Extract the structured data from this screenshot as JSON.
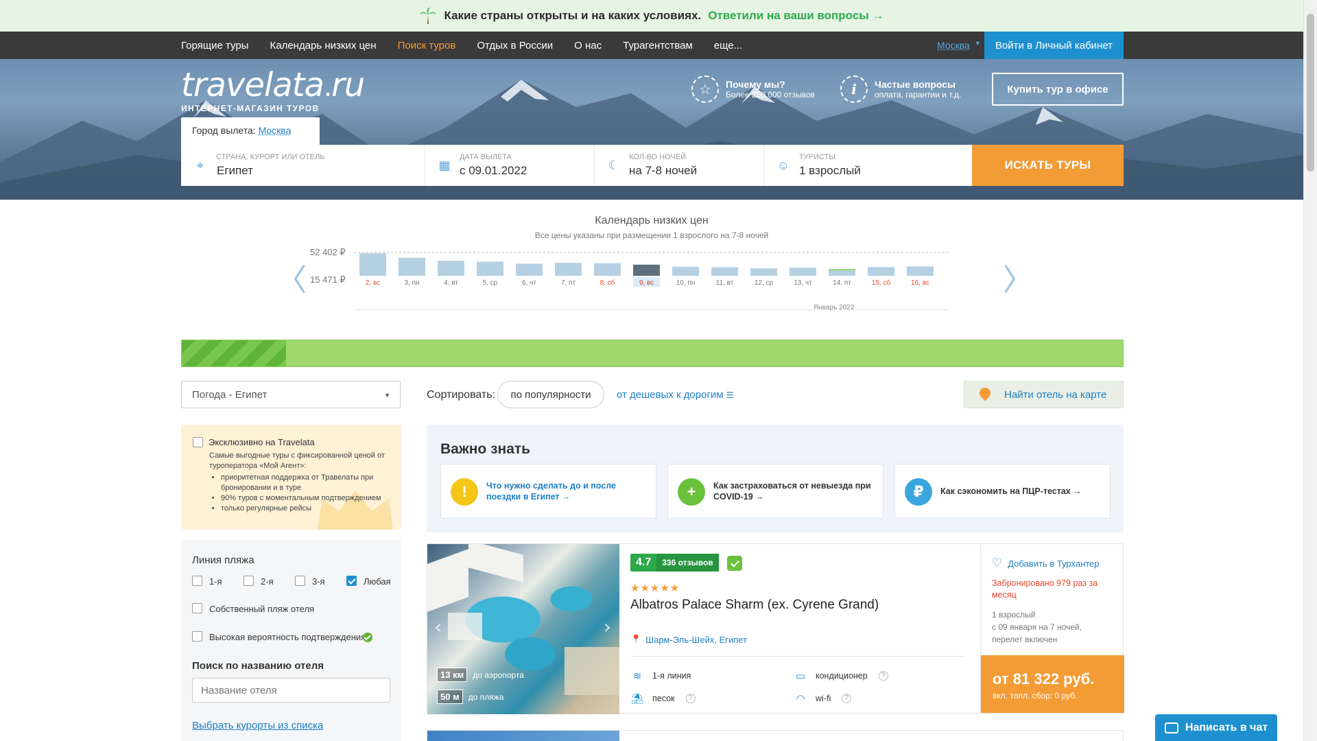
{
  "banner": {
    "question": "Какие страны открыты и на каких условиях.",
    "link": "Ответили на ваши вопросы"
  },
  "nav": {
    "items": [
      "Горящие туры",
      "Календарь низких цен",
      "Поиск туров",
      "Отдых в России",
      "О нас",
      "Турагентствам",
      "еще..."
    ],
    "active_index": 2,
    "city": "Москва",
    "login": "Войти в Личный кабинет"
  },
  "header": {
    "logo": "travelata.ru",
    "logo_main": "travelata",
    "logo_suffix": "ru",
    "tagline": "ИНТЕРНЕТ-МАГАЗИН ТУРОВ",
    "why_title": "Почему мы?",
    "why_sub": "Более 250 000 отзывов",
    "faq_title": "Частые вопросы",
    "faq_sub": "оплата, гарантии и т.д.",
    "office_button": "Купить тур в офисе"
  },
  "search": {
    "departure_label": "Город вылета:",
    "departure_city": "Москва",
    "destination_label": "СТРАНА, КУРОРТ ИЛИ ОТЕЛЬ",
    "destination_value": "Египет",
    "date_label": "ДАТА ВЫЛЕТА",
    "date_value": "с 09.01.2022",
    "nights_label": "КОЛ-ВО НОЧЕЙ",
    "nights_value": "на 7-8 ночей",
    "tourists_label": "ТУРИСТЫ",
    "tourists_value": "1 взрослый",
    "button": "ИСКАТЬ ТУРЫ"
  },
  "calendar": {
    "title": "Календарь низких цен",
    "subtitle": "Все цены указаны при размещении 1 взрослого на 7-8 ночей",
    "max_label": "52 402 ₽",
    "min_label": "15 471 ₽",
    "month": "Январь 2022"
  },
  "chart_data": {
    "type": "bar",
    "categories": [
      "2, вс",
      "3, пн",
      "4, вт",
      "5, ср",
      "6, чт",
      "7, пт",
      "8, сб",
      "9, вс",
      "10, пн",
      "11, вт",
      "12, ср",
      "13, чт",
      "14, пт",
      "15, сб",
      "16, вс"
    ],
    "values": [
      52402,
      41800,
      35000,
      32700,
      28000,
      30100,
      29300,
      25800,
      21000,
      19600,
      17200,
      18900,
      15471,
      20100,
      21700
    ],
    "weekend": [
      true,
      false,
      false,
      false,
      false,
      false,
      true,
      true,
      false,
      false,
      false,
      false,
      false,
      true,
      true
    ],
    "selected_index": 7,
    "min_index": 12,
    "ylim": [
      0,
      52402
    ],
    "colors": {
      "bar": "#b6d0e3",
      "selected": "#5f6f7c",
      "min": "#8fd46a",
      "weekend_label": "#e8472d"
    }
  },
  "progress": {
    "fraction": 0.111
  },
  "sort": {
    "weather": "Погода - Египет",
    "label": "Сортировать:",
    "popular": "по популярности",
    "cheap": "от дешевых к дорогим",
    "map": "Найти отель на карте"
  },
  "exclusive": {
    "title": "Эксклюзивно на Travelata",
    "desc": "Самые выгодные туры с фиксированной ценой от туроператора «Мой Агент»:",
    "points": [
      "приоритетная поддержка от Травелаты при бронировании и в туре",
      "90% туров с моментальным подтверждением",
      "только регулярные рейсы"
    ]
  },
  "filters": {
    "beach_title": "Линия пляжа",
    "beach_options": [
      "1-я",
      "2-я",
      "3-я",
      "Любая"
    ],
    "beach_checked": "Любая",
    "own_beach": "Собственный пляж отеля",
    "high_confirm": "Высокая вероятность подтверждения",
    "name_title": "Поиск по названию отеля",
    "name_placeholder": "Название отеля",
    "resorts_link": "Выбрать курорты из списка"
  },
  "important": {
    "title": "Важно знать",
    "cards": [
      {
        "icon": "!",
        "color": "#f5c518",
        "text": "Что нужно сделать до и после поездки в Египет →",
        "link": true
      },
      {
        "icon": "+",
        "color": "#6bc03c",
        "text": "Как застраховаться от невыезда при COVID-19 →",
        "link": false
      },
      {
        "icon": "₽",
        "color": "#3aa6dd",
        "text": "Как сэкономить на ПЦР-тестах →",
        "link": false
      }
    ]
  },
  "hotel": {
    "rating": "4.7",
    "reviews": "336 отзывов",
    "stars": "★★★★★",
    "name": "Albatros Palace Sharm (ex. Cyrene Grand)",
    "location": "Шарм-Эль-Шейх, Египет",
    "airport_dist": "13 км",
    "airport_label": "до аэропорта",
    "beach_dist": "50 м",
    "beach_label": "до пляжа",
    "features": [
      "1-я линия",
      "кондиционер",
      "песок",
      "wi-fi"
    ],
    "fav": "Добавить в Турхантер",
    "booked": "Забронировано 979 раз за месяц",
    "meta1": "1 взрослый",
    "meta2": "с 09 января на 7 ночей,",
    "meta3": "перелет включен",
    "price": "от 81 322 руб.",
    "fee": "вкл. топл. сбор: 0 руб."
  },
  "chat": "Написать в чат"
}
